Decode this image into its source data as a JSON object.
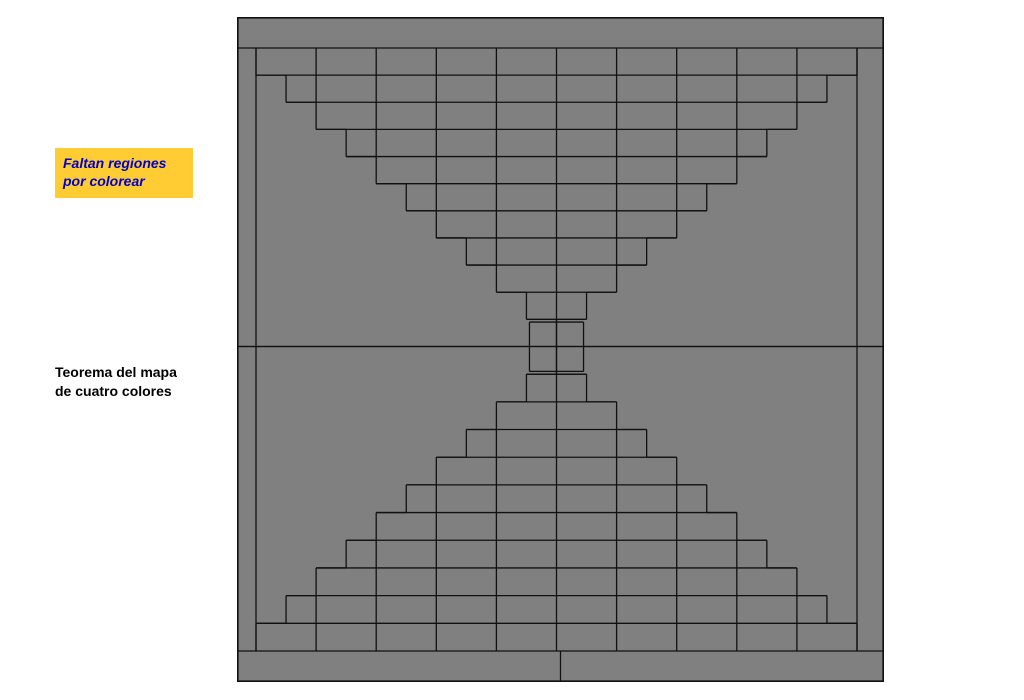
{
  "status": {
    "line1": "Faltan regiones",
    "line2": "por colorear"
  },
  "title": {
    "line1": "Teorema del mapa",
    "line2": "de cuatro colores"
  },
  "diagram": {
    "background_color": "#808080",
    "stroke_color": "#111111",
    "outer_width": 645,
    "outer_height": 663,
    "description": "Concentric staggered-brick pattern for four-color map theorem, uncolored (all gray)."
  }
}
